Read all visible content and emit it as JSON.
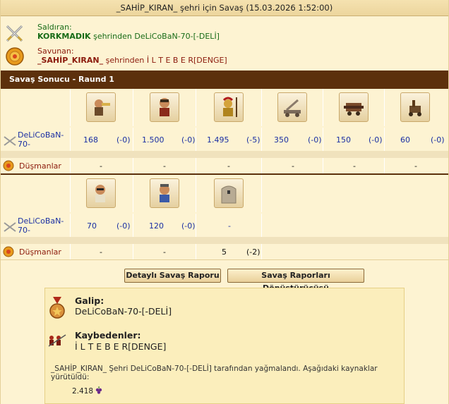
{
  "title": "_SAHİP_KIRAN_ şehri için Savaş (15.03.2026 1:52:00)",
  "attacker": {
    "role": "Saldıran:",
    "city": "KORKMADIK",
    "from_text": " şehrinden ",
    "player": "DeLiCoBaN-70-[-DELİ]",
    "icon": "crossed-swords-icon"
  },
  "defender": {
    "role": "Savunan:",
    "city": "_SAHİP_KIRAN_",
    "from_text": " şehrinden ",
    "player": "İ L T E B E R[DENGE]",
    "icon": "shield-icon"
  },
  "round_header": "Savaş Sonucu - Raund 1",
  "rows": {
    "attacker_label": "DeLiCoBaN-70-",
    "enemy_label": "Düşmanlar"
  },
  "block1": {
    "units": [
      "trumpeter-icon",
      "slinger-icon",
      "hoplite-icon",
      "catapult-icon",
      "battering-ram-icon",
      "ballista-icon"
    ],
    "attacker": [
      {
        "count": "168",
        "loss": "(-0)"
      },
      {
        "count": "1.500",
        "loss": "(-0)"
      },
      {
        "count": "1.495",
        "loss": "(-5)"
      },
      {
        "count": "350",
        "loss": "(-0)"
      },
      {
        "count": "150",
        "loss": "(-0)"
      },
      {
        "count": "60",
        "loss": "(-0)"
      }
    ],
    "enemy": [
      "-",
      "-",
      "-",
      "-",
      "-",
      "-"
    ]
  },
  "block2": {
    "units": [
      "doctor-icon",
      "cook-icon",
      "wall-icon"
    ],
    "attacker": [
      {
        "count": "70",
        "loss": "(-0)"
      },
      {
        "count": "120",
        "loss": "(-0)"
      },
      {
        "count": "-",
        "loss": ""
      }
    ],
    "enemy": [
      {
        "count": "-",
        "loss": ""
      },
      {
        "count": "-",
        "loss": ""
      },
      {
        "count": "5",
        "loss": "(-2)"
      }
    ]
  },
  "buttons": {
    "detailed": "Detaylı Savaş Raporu",
    "converter": "Savaş Raporları Dönüştürücüsü"
  },
  "result": {
    "winner_label": "Galip:",
    "winner": "DeLiCoBaN-70-[-DELİ]",
    "loser_label": "Kaybedenler:",
    "loser": "İ L T E B E R[DENGE]",
    "note": "_SAHİP_KIRAN_ Şehri DeLiCoBaN-70-[-DELİ] tarafından yağmalandı. Aşağıdaki kaynaklar yürütüldü:",
    "resource_amount": "2.418",
    "resource_icon": "wine-grapes-icon"
  }
}
